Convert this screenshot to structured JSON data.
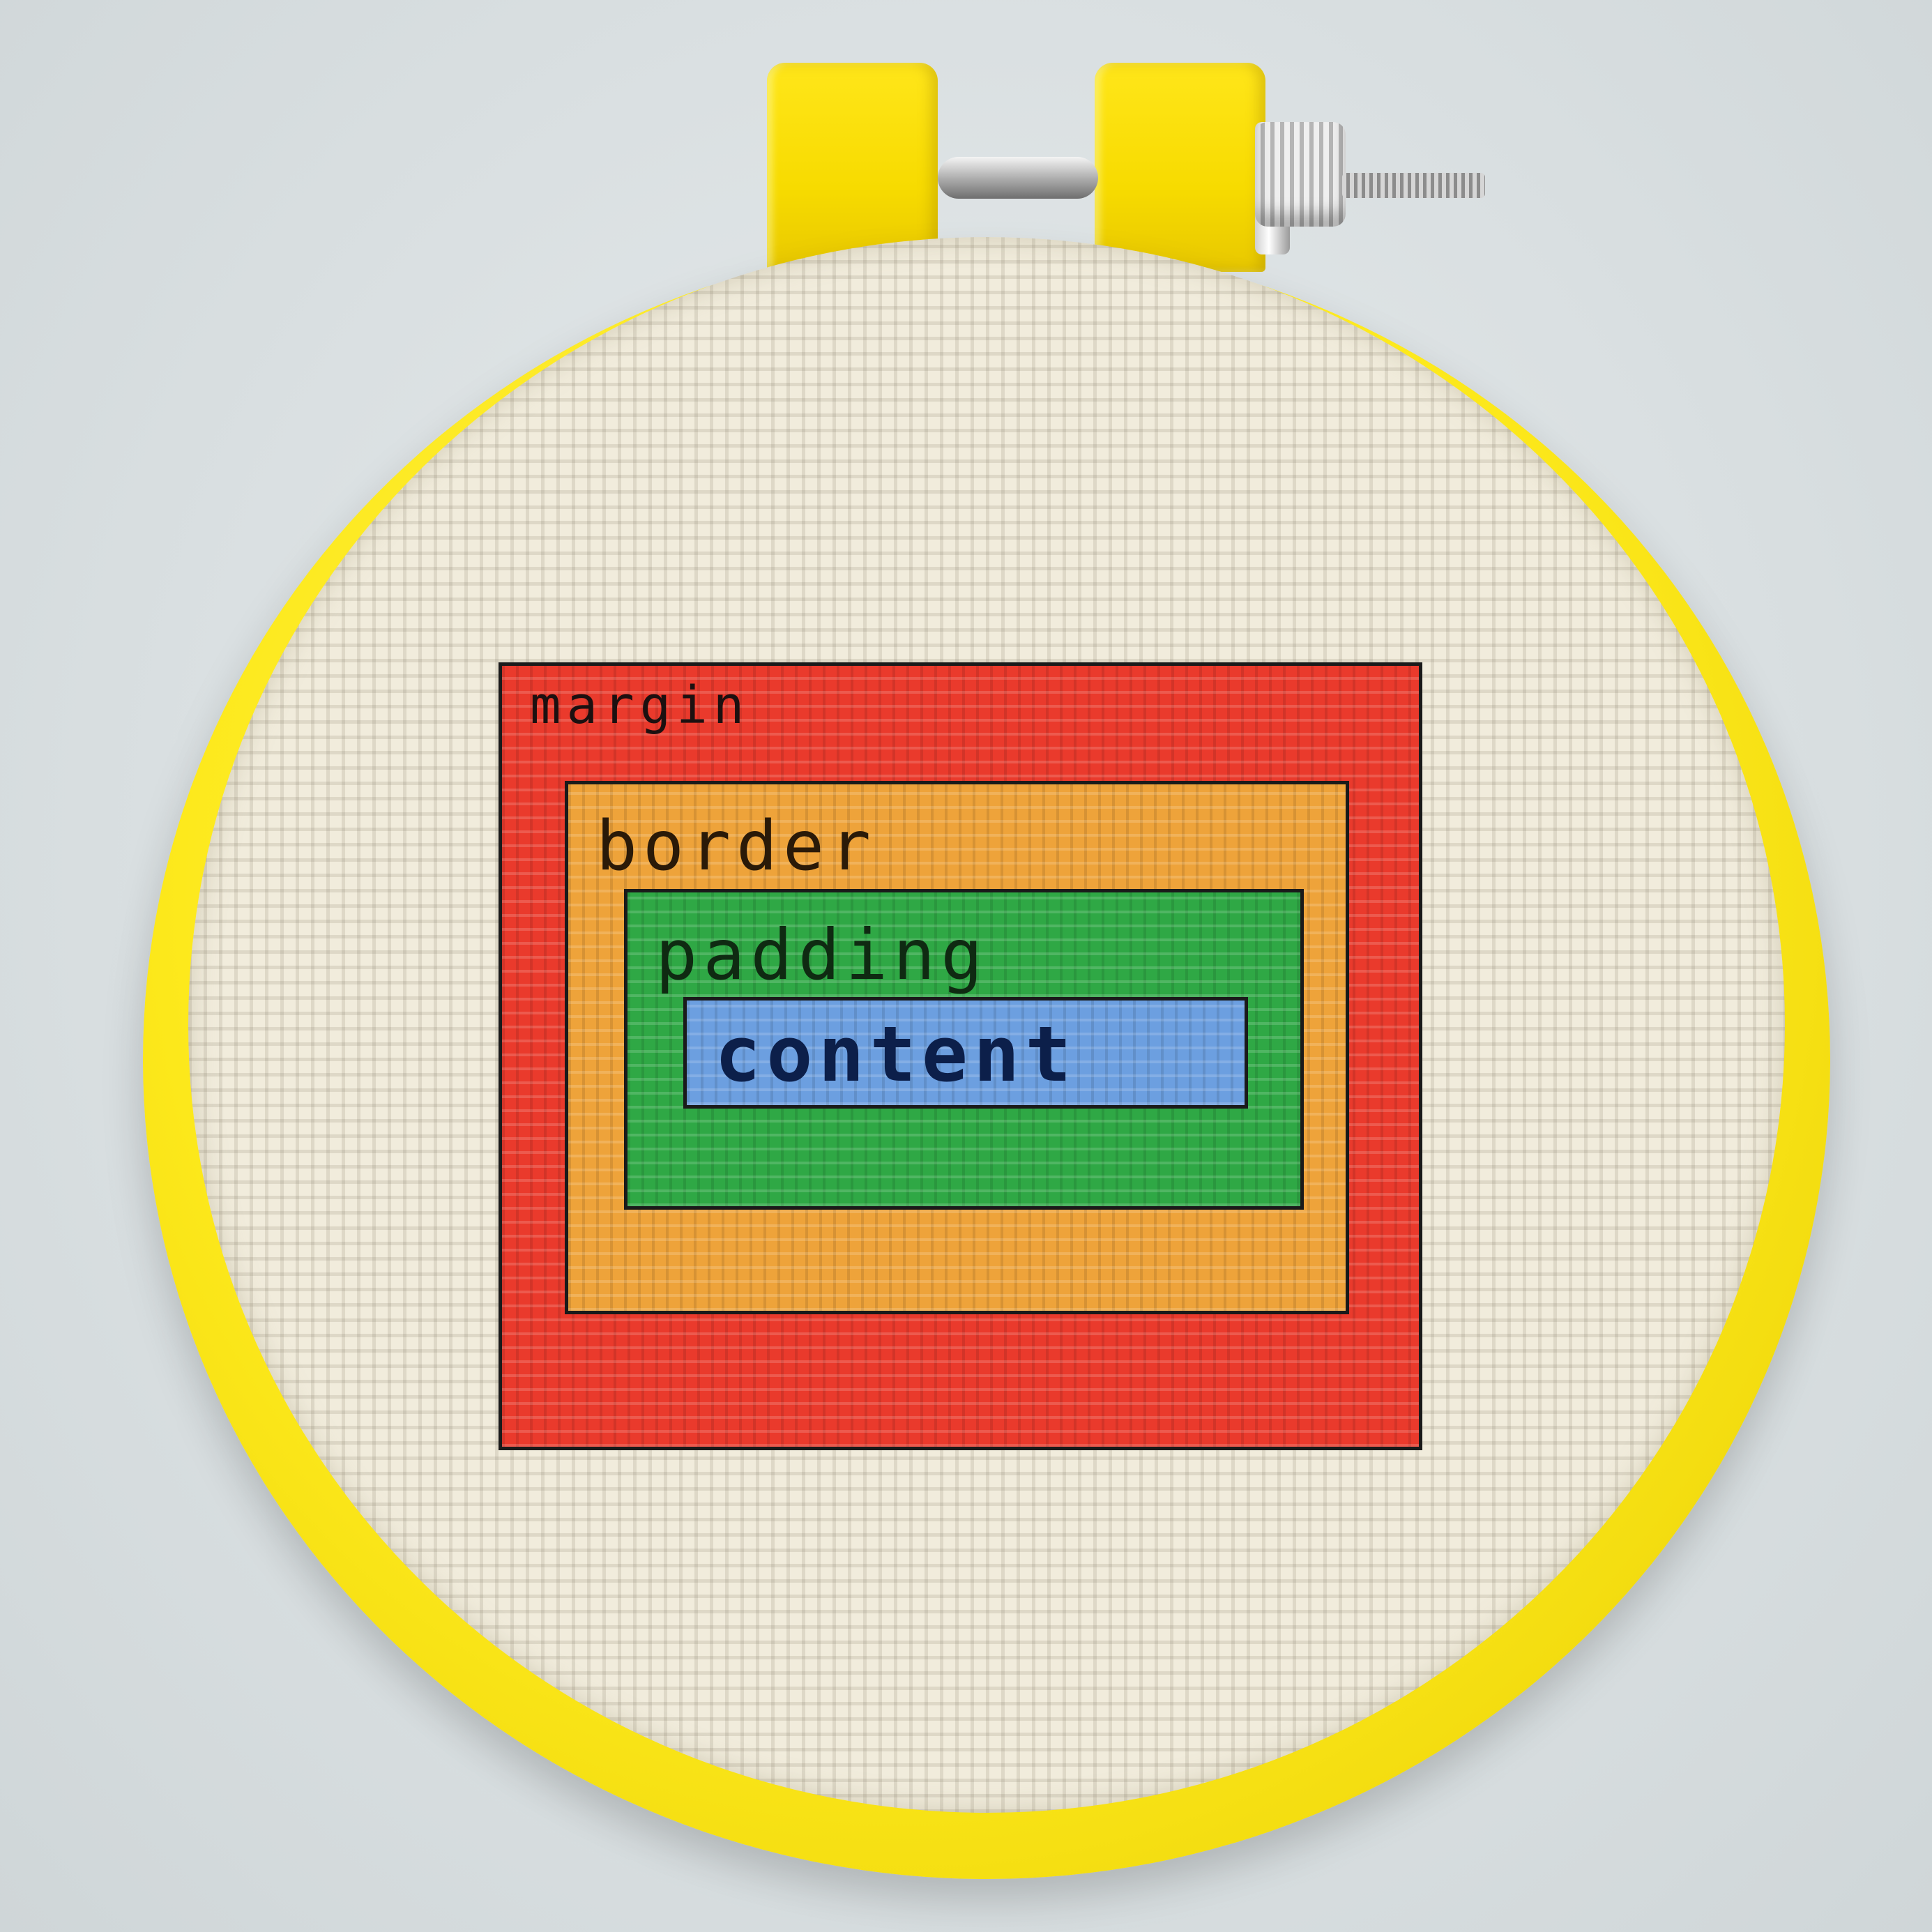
{
  "photo": {
    "subject": "embroidery-hoop",
    "colors": {
      "hoop": "#fde91c",
      "fabric": "#f1ecdc",
      "margin": "#ea3a2c",
      "border": "#eea33a",
      "padding": "#2fa845",
      "content": "#6c9fe0",
      "outline": "#1a1a1a"
    }
  },
  "box_model": {
    "margin_label": "margin",
    "border_label": "border",
    "padding_label": "padding",
    "content_label": "content"
  }
}
